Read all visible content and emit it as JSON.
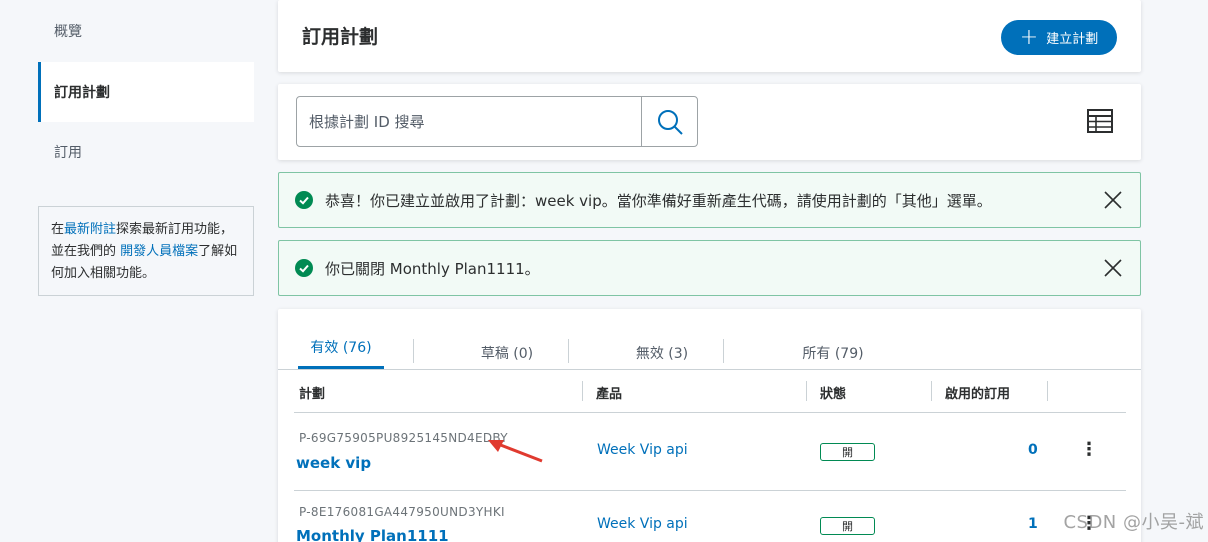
{
  "sidebar": {
    "items": [
      {
        "label": "概覽"
      },
      {
        "label": "訂用計劃"
      },
      {
        "label": "訂用"
      }
    ],
    "note": {
      "prefix": "在",
      "link1": "最新附註",
      "middle": "探索最新訂用功能，並在我們的 ",
      "link2": "開發人員檔案",
      "suffix": "了解如何加入相關功能。"
    }
  },
  "header": {
    "title": "訂用計劃",
    "create_label": "建立計劃"
  },
  "search": {
    "placeholder": "根據計劃 ID 搜尋"
  },
  "alerts": [
    {
      "text": "恭喜！你已建立並啟用了計劃：week vip。當你準備好重新產生代碼，請使用計劃的「其他」選單。"
    },
    {
      "text": "你已關閉 Monthly Plan1111。"
    }
  ],
  "tabs": [
    {
      "label": "有效 (76)"
    },
    {
      "label": "草稿 (0)"
    },
    {
      "label": "無效 (3)"
    },
    {
      "label": "所有 (79)"
    }
  ],
  "table": {
    "headers": [
      "計劃",
      "產品",
      "狀態",
      "啟用的訂用"
    ],
    "rows": [
      {
        "id": "P-69G75905PU8925145ND4EDBY",
        "name": "week vip",
        "product": "Week Vip api",
        "status": "開",
        "count": "0",
        "menu": "⋮"
      },
      {
        "id": "P-8E176081GA447950UND3YHKI",
        "name": "Monthly Plan1111",
        "product": "Week Vip api",
        "status": "開",
        "count": "1",
        "menu": "⋮"
      }
    ]
  },
  "watermark": "CSDN @小吴-斌",
  "colors": {
    "accent": "#0070ba",
    "success": "#018a53",
    "alert_bg": "#f2faf6"
  }
}
